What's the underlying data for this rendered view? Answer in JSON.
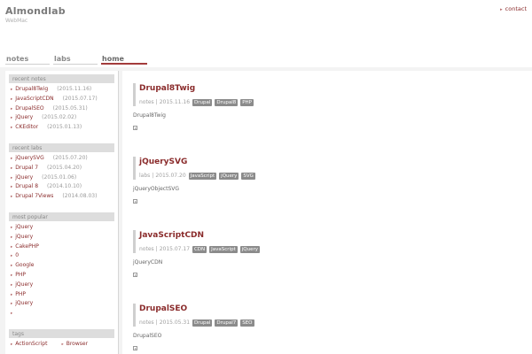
{
  "site": {
    "title": "Almondlab",
    "subtitle": "WebMac",
    "contact": "contact"
  },
  "nav": [
    {
      "label": "notes"
    },
    {
      "label": "labs"
    },
    {
      "label": "home",
      "active": true
    }
  ],
  "sidebar": {
    "recent_notes": {
      "title": "recent notes",
      "items": [
        {
          "label": "Drupal8Twig",
          "date": "(2015.11.16)"
        },
        {
          "label": "JavaScriptCDN",
          "date": "(2015.07.17)"
        },
        {
          "label": "DrupalSEO",
          "date": "(2015.05.31)"
        },
        {
          "label": "jQuery",
          "date": "(2015.02.02)"
        },
        {
          "label": "CKEditor",
          "date": "(2015.01.13)"
        }
      ]
    },
    "recent_labs": {
      "title": "recent labs",
      "items": [
        {
          "label": "jQuerySVG",
          "date": "(2015.07.20)"
        },
        {
          "label": "Drupal 7",
          "date": "(2015.04.20)"
        },
        {
          "label": "jQuery",
          "date": "(2015.01.06)"
        },
        {
          "label": "Drupal 8",
          "date": "(2014.10.10)"
        },
        {
          "label": "Drupal 7Views",
          "date": "(2014.08.03)"
        }
      ]
    },
    "most_popular": {
      "title": "most popular",
      "items": [
        {
          "label": "jQuery"
        },
        {
          "label": "jQuery"
        },
        {
          "label": "CakePHP"
        },
        {
          "label": "0"
        },
        {
          "label": "Google"
        },
        {
          "label": "PHP"
        },
        {
          "label": "jQuery"
        },
        {
          "label": "PHP"
        },
        {
          "label": "jQuery"
        },
        {
          "label": ""
        }
      ]
    },
    "tags": {
      "title": "tags",
      "items": [
        {
          "label": "ActionScript"
        },
        {
          "label": "Browser"
        }
      ]
    }
  },
  "posts": [
    {
      "title": "Drupal8Twig",
      "section": "notes",
      "date": "2015.11.16",
      "tags": [
        "Drupal",
        "Drupal8",
        "PHP"
      ],
      "body": "Drupal8Twig"
    },
    {
      "title": "jQuerySVG",
      "section": "labs",
      "date": "2015.07.20",
      "tags": [
        "JavaScript",
        "jQuery",
        "SVG"
      ],
      "body": "jQueryObjectSVG"
    },
    {
      "title": "JavaScriptCDN",
      "section": "notes",
      "date": "2015.07.17",
      "tags": [
        "CDN",
        "JavaScript",
        "jQuery"
      ],
      "body": "jQueryCDN"
    },
    {
      "title": "DrupalSEO",
      "section": "notes",
      "date": "2015.05.31",
      "tags": [
        "Drupal",
        "Drupal7",
        "SEO"
      ],
      "body": "DrupalSEO"
    }
  ],
  "icons": {
    "bullet": "right-triangle-icon",
    "read_more": "read-more-icon"
  },
  "colors": {
    "accent": "#8a2b2b",
    "active_underline": "#a33b3b",
    "tag_bg": "#8b8b8b",
    "block_title_bg": "#dddddd"
  }
}
